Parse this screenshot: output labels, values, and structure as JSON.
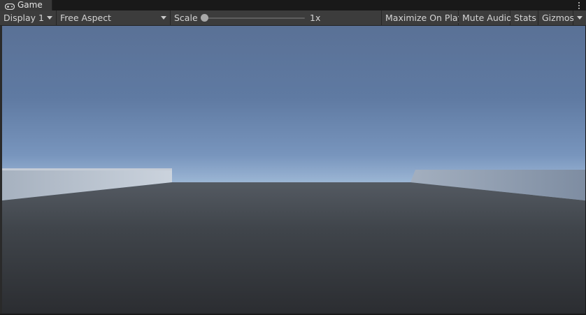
{
  "tab": {
    "title": "Game",
    "icon": "gamepad-icon"
  },
  "toolbar": {
    "display": "Display 1",
    "aspect": "Free Aspect",
    "scale_label": "Scale",
    "scale_value": "1x",
    "scale_level": 0.0,
    "maximize": "Maximize On Play",
    "mute": "Mute Audio",
    "stats": "Stats",
    "gizmos": "Gizmos"
  },
  "colors": {
    "sky_top": "#5a7196",
    "horizon": "#ffffff",
    "floor_near": "#2f3236",
    "floor_far": "#4f555c"
  }
}
